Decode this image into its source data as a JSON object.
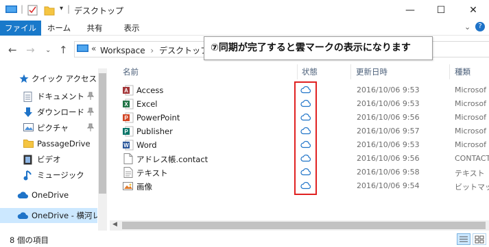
{
  "window": {
    "title": "デスクトップ",
    "controls": {
      "minimize": "—",
      "maximize": "☐",
      "close": "✕"
    }
  },
  "ribbon": {
    "tabs": [
      "ファイル",
      "ホーム",
      "共有",
      "表示"
    ]
  },
  "address": {
    "prefix": "«",
    "path": [
      "Workspace",
      "デスクトップ"
    ],
    "separator": "›"
  },
  "callout": {
    "text": "⑦同期が完了すると雲マークの表示になります"
  },
  "nav": {
    "items": [
      {
        "label": "クイック アクセス",
        "icon": "star-icon",
        "pinned": false
      },
      {
        "label": "ドキュメント",
        "icon": "document-icon",
        "pinned": true
      },
      {
        "label": "ダウンロード",
        "icon": "download-icon",
        "pinned": true
      },
      {
        "label": "ピクチャ",
        "icon": "picture-icon",
        "pinned": true
      },
      {
        "label": "PassageDrive",
        "icon": "folder-icon",
        "pinned": false
      },
      {
        "label": "ビデオ",
        "icon": "video-icon",
        "pinned": false
      },
      {
        "label": "ミュージック",
        "icon": "music-icon",
        "pinned": false
      },
      {
        "label": "OneDrive",
        "icon": "cloud-icon",
        "pinned": false
      },
      {
        "label": "OneDrive - 横河レ",
        "icon": "cloud-icon",
        "pinned": false
      }
    ]
  },
  "columns": {
    "name": "名前",
    "status": "状態",
    "date": "更新日時",
    "type": "種類"
  },
  "files": [
    {
      "name": "Access",
      "date": "2016/10/06 9:53",
      "type": "Microsof",
      "icon": "access-icon",
      "color": "#a4373a"
    },
    {
      "name": "Excel",
      "date": "2016/10/06 9:53",
      "type": "Microsof",
      "icon": "excel-icon",
      "color": "#217346"
    },
    {
      "name": "PowerPoint",
      "date": "2016/10/06 9:56",
      "type": "Microsof",
      "icon": "powerpoint-icon",
      "color": "#d24726"
    },
    {
      "name": "Publisher",
      "date": "2016/10/06 9:57",
      "type": "Microsof",
      "icon": "publisher-icon",
      "color": "#077568"
    },
    {
      "name": "Word",
      "date": "2016/10/06 9:53",
      "type": "Microsof",
      "icon": "word-icon",
      "color": "#2b579a"
    },
    {
      "name": "アドレス帳.contact",
      "date": "2016/10/06 9:56",
      "type": "CONTACT",
      "icon": "contact-file-icon",
      "color": "#ffffff"
    },
    {
      "name": "テキスト",
      "date": "2016/10/06 9:58",
      "type": "テキスト ド",
      "icon": "text-file-icon",
      "color": "#ffffff"
    },
    {
      "name": "画像",
      "date": "2016/10/06 9:54",
      "type": "ビットマップ",
      "icon": "image-file-icon",
      "color": "#ffffff"
    }
  ],
  "status": {
    "count": "8 個の項目"
  },
  "colors": {
    "accent": "#1979ca",
    "cloud": "#1e73c8",
    "highlight": "#e02020",
    "selected": "#cce8ff"
  }
}
